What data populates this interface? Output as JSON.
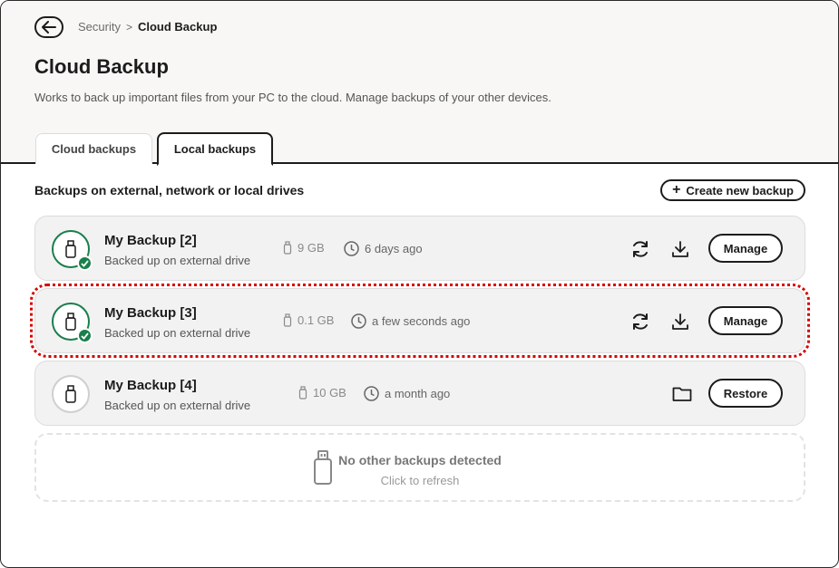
{
  "breadcrumb": {
    "parent": "Security",
    "separator": ">",
    "current": "Cloud Backup"
  },
  "page": {
    "title": "Cloud Backup",
    "description": "Works to back up important files from your PC to the cloud. Manage backups of your other devices."
  },
  "tabs": [
    {
      "label": "Cloud backups",
      "active": false
    },
    {
      "label": "Local backups",
      "active": true
    }
  ],
  "section": {
    "title": "Backups on external, network or local drives",
    "create_label": "Create new backup"
  },
  "backups": [
    {
      "name": "My Backup [2]",
      "subtitle": "Backed up on external drive",
      "size": "9 GB",
      "time": "6 days ago",
      "action": "Manage",
      "status": "ok"
    },
    {
      "name": "My Backup [3]",
      "subtitle": "Backed up on external drive",
      "size": "0.1 GB",
      "time": "a few seconds ago",
      "action": "Manage",
      "status": "ok"
    },
    {
      "name": "My Backup [4]",
      "subtitle": "Backed up on external drive",
      "size": "10 GB",
      "time": "a month ago",
      "action": "Restore",
      "status": "none"
    }
  ],
  "empty": {
    "title": "No other backups detected",
    "subtitle": "Click to refresh"
  },
  "colors": {
    "accent_green": "#1a7f4b",
    "highlight_red": "#d60000",
    "text_dark": "#1c1c1c"
  }
}
